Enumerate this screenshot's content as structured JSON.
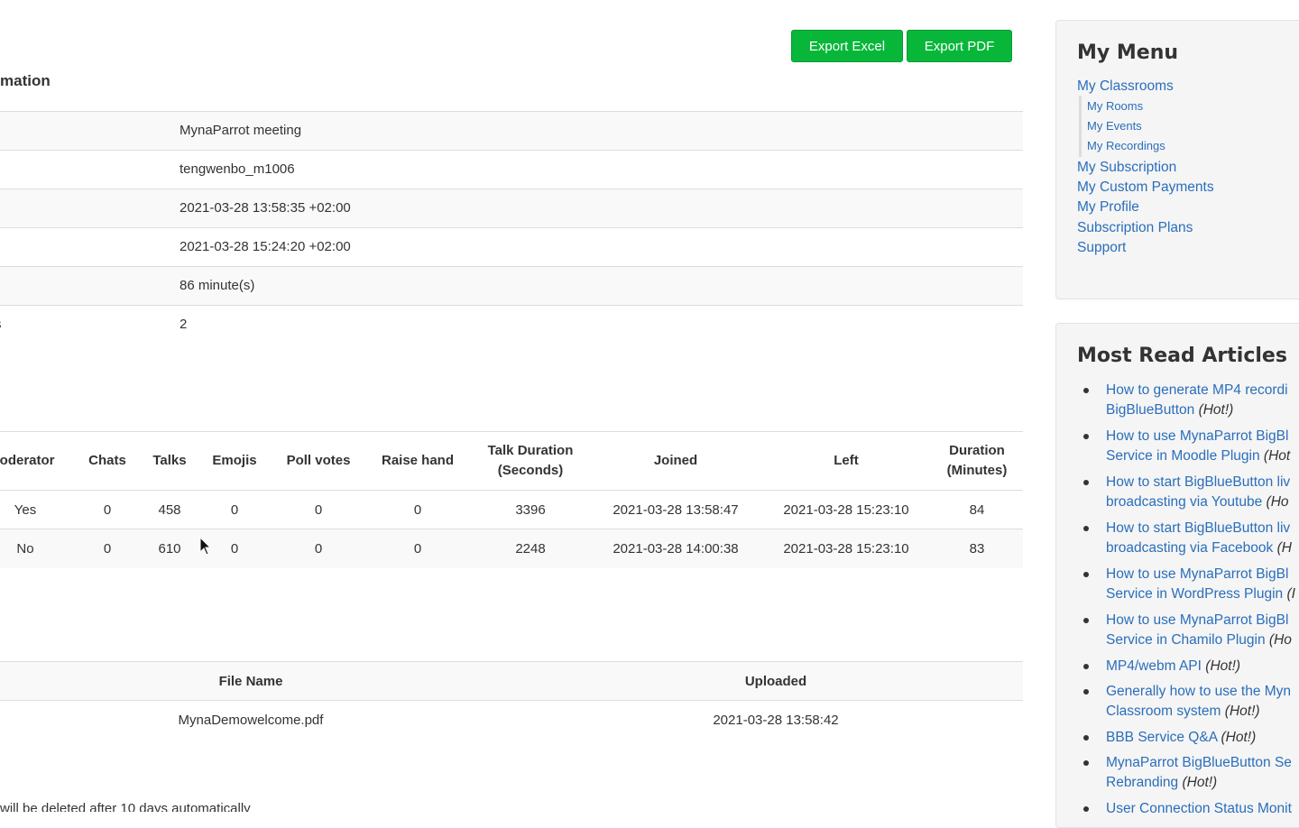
{
  "toolbar": {
    "export_excel": "Export Excel",
    "export_pdf": "Export PDF"
  },
  "info": {
    "title": "mation",
    "rows": [
      {
        "label": "",
        "value": "MynaParrot meeting"
      },
      {
        "label": "",
        "value": "tengwenbo_m1006"
      },
      {
        "label": "",
        "value": "2021-03-28 13:58:35 +02:00"
      },
      {
        "label": "",
        "value": "2021-03-28 15:24:20 +02:00"
      },
      {
        "label": "",
        "value": "86 minute(s)"
      },
      {
        "label": "s",
        "value": "2"
      }
    ]
  },
  "attendance": {
    "headers": [
      "loderator",
      "Chats",
      "Talks",
      "Emojis",
      "Poll votes",
      "Raise hand",
      "Talk Duration\n(Seconds)",
      "Joined",
      "Left",
      "Duration\n(Minutes)"
    ],
    "rows": [
      [
        "Yes",
        "0",
        "458",
        "0",
        "0",
        "0",
        "3396",
        "2021-03-28 13:58:47",
        "2021-03-28 15:23:10",
        "84"
      ],
      [
        "No",
        "0",
        "610",
        "0",
        "0",
        "0",
        "2248",
        "2021-03-28 14:00:38",
        "2021-03-28 15:23:10",
        "83"
      ]
    ]
  },
  "files": {
    "headers": [
      "File Name",
      "Uploaded"
    ],
    "rows": [
      [
        "MynaDemowelcome.pdf",
        "2021-03-28 13:58:42"
      ]
    ]
  },
  "footnote": "will be deleted after 10 days automatically",
  "my_menu": {
    "title": "My Menu",
    "classrooms": "My Classrooms",
    "sub_items": [
      "My Rooms",
      "My Events",
      "My Recordings"
    ],
    "items": [
      "My Subscription",
      "My Custom Payments",
      "My Profile",
      "Subscription Plans",
      "Support"
    ]
  },
  "articles": {
    "title": "Most Read Articles",
    "hot_label": "(Hot!)",
    "items": [
      {
        "line1": "How to generate MP4 recordi",
        "line2": "BigBlueButton",
        "hot": "(Hot!)"
      },
      {
        "line1": "How to use MynaParrot BigBl",
        "line2": "Service in Moodle Plugin",
        "hot": "(Hot"
      },
      {
        "line1": "How to start BigBlueButton liv",
        "line2": "broadcasting via Youtube",
        "hot": "(Ho"
      },
      {
        "line1": "How to start BigBlueButton liv",
        "line2": "broadcasting via Facebook",
        "hot": "(H"
      },
      {
        "line1": "How to use MynaParrot BigBl",
        "line2": "Service in WordPress Plugin",
        "hot": "(I"
      },
      {
        "line1": "How to use MynaParrot BigBl",
        "line2": "Service in Chamilo Plugin",
        "hot": "(Ho"
      },
      {
        "line1": "MP4/webm API",
        "line2": "",
        "hot": "(Hot!)"
      },
      {
        "line1": "Generally how to use the Myn",
        "line2": "Classroom system",
        "hot": "(Hot!)"
      },
      {
        "line1": "BBB Service Q&A",
        "line2": "",
        "hot": "(Hot!)"
      },
      {
        "line1": "MynaParrot BigBlueButton Se",
        "line2": "Rebranding",
        "hot": "(Hot!)"
      },
      {
        "line1": "User Connection Status Monit",
        "line2": "",
        "hot": ""
      }
    ]
  }
}
